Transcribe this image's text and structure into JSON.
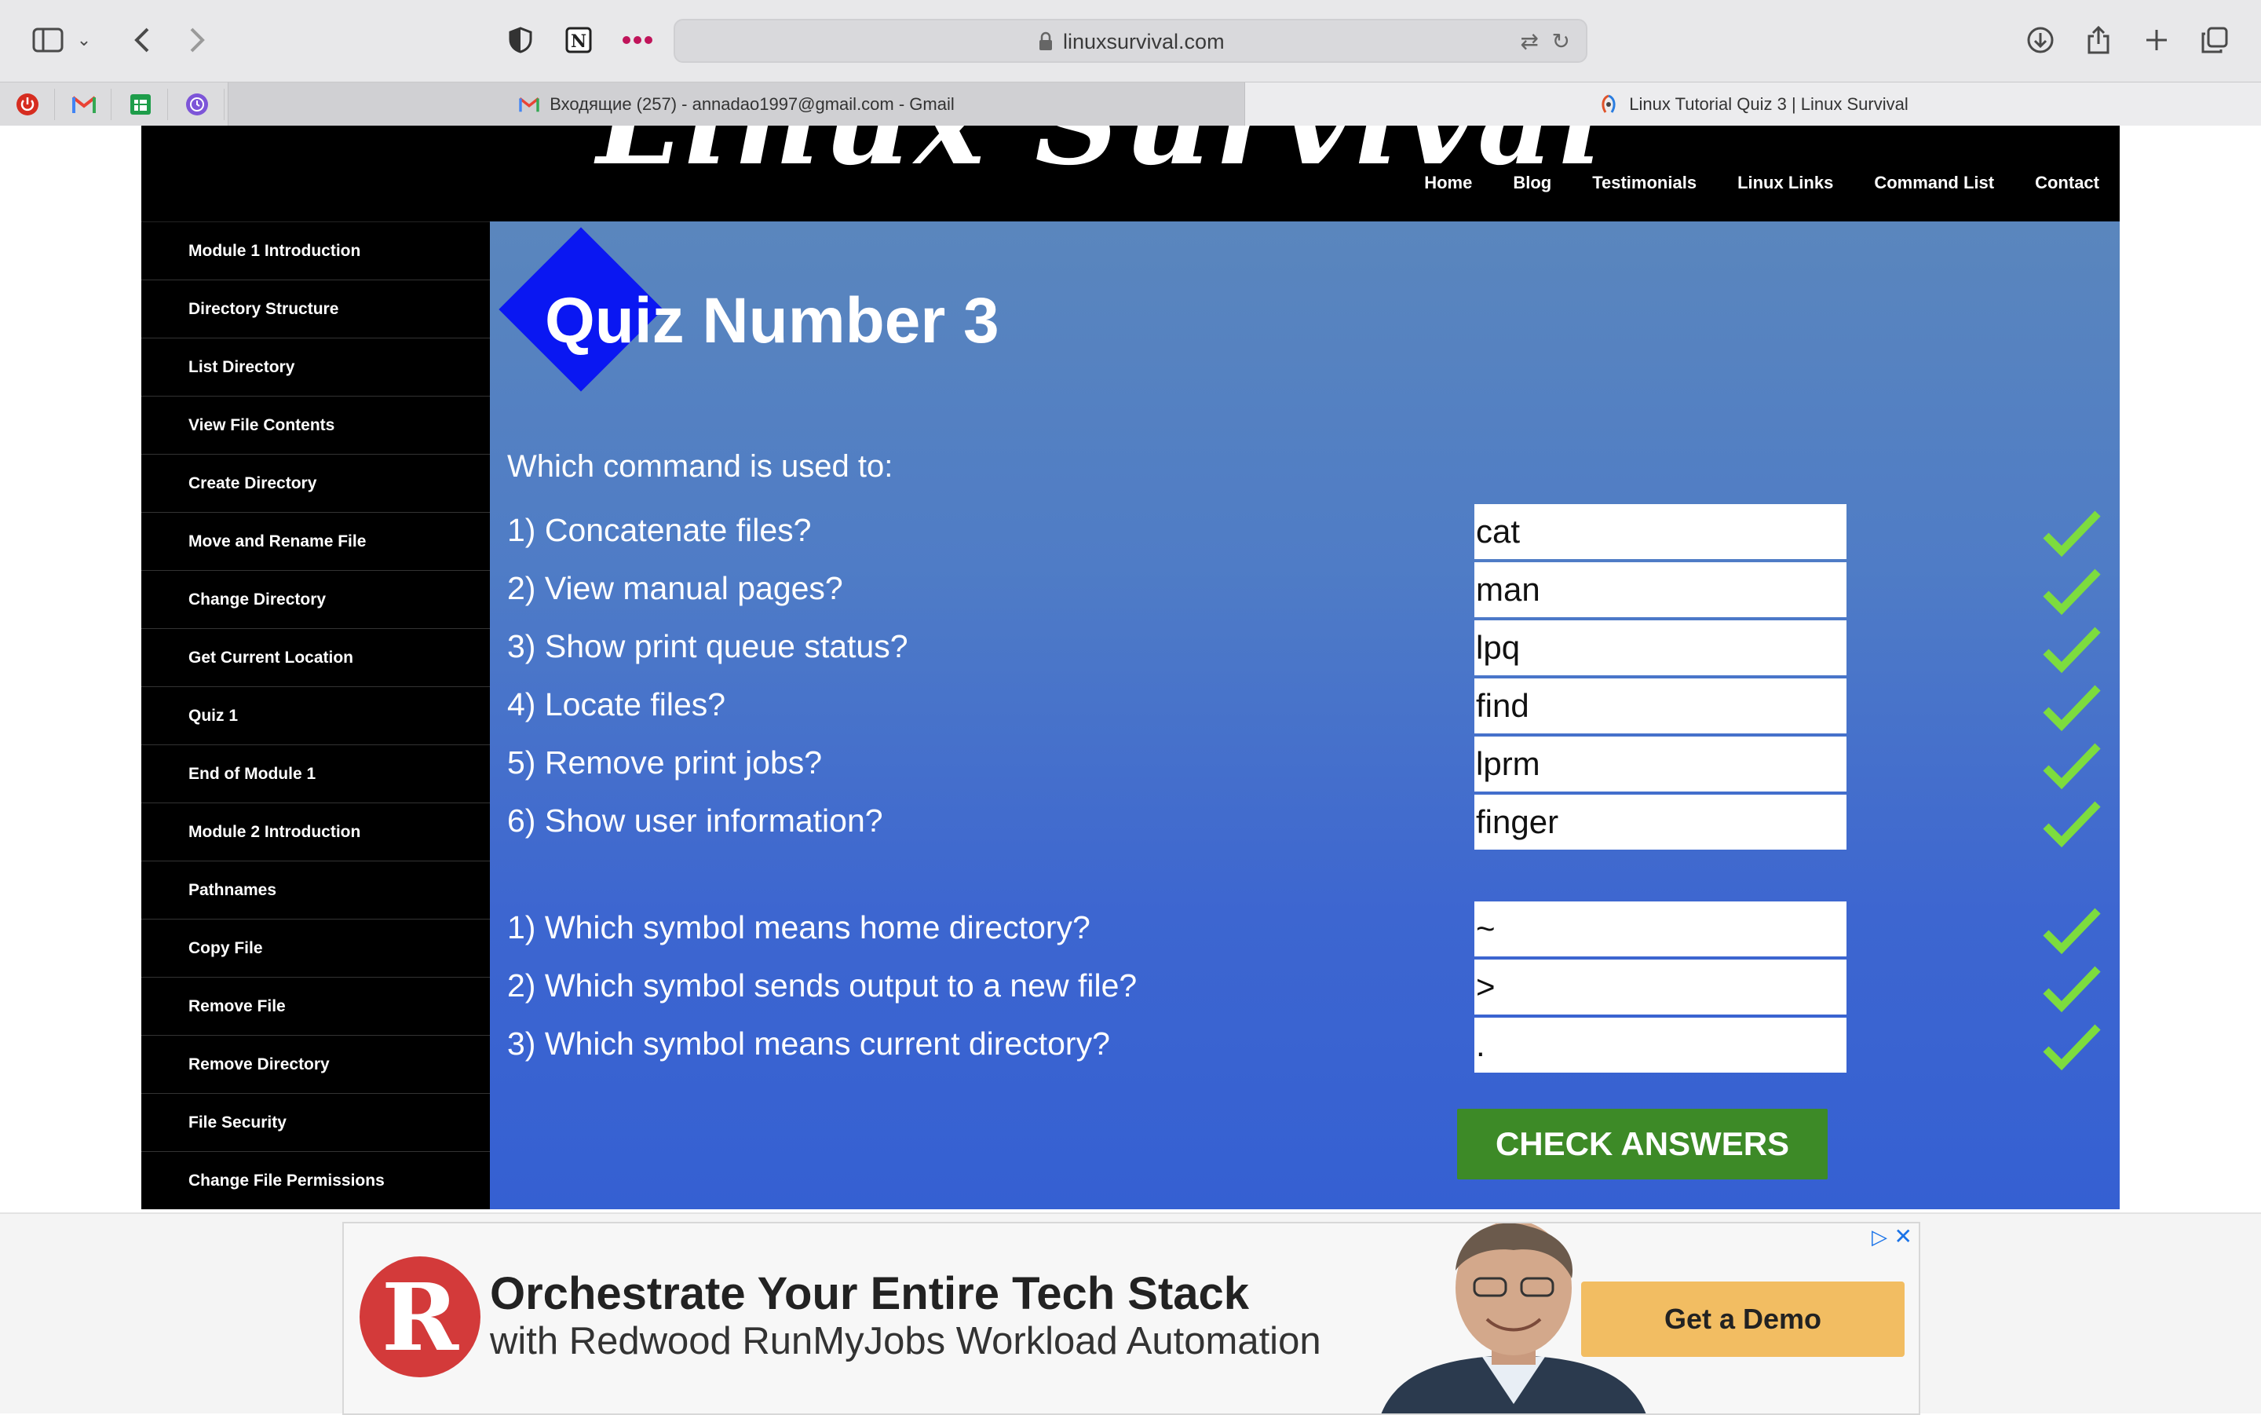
{
  "browser": {
    "url": "linuxsurvival.com",
    "tabs": [
      {
        "label": "Входящие (257) - annadao1997@gmail.com - Gmail",
        "active": false
      },
      {
        "label": "Linux Tutorial Quiz 3 | Linux Survival",
        "active": true
      }
    ],
    "pinned_tabs": [
      "power-icon",
      "gmail-icon",
      "sheets-icon",
      "clock-icon"
    ]
  },
  "site": {
    "logo_text": "Linux Survival",
    "nav": [
      "Home",
      "Blog",
      "Testimonials",
      "Linux Links",
      "Command List",
      "Contact"
    ]
  },
  "sidebar": {
    "items": [
      "Module 1 Introduction",
      "Directory Structure",
      "List Directory",
      "View File Contents",
      "Create Directory",
      "Move and Rename File",
      "Change Directory",
      "Get Current Location",
      "Quiz 1",
      "End of Module 1",
      "Module 2 Introduction",
      "Pathnames",
      "Copy File",
      "Remove File",
      "Remove Directory",
      "File Security",
      "Change File Permissions"
    ]
  },
  "quiz": {
    "title": "Quiz Number 3",
    "heading": "Which command is used to:",
    "questions": [
      {
        "text": "1) Concatenate files?",
        "answer": "cat",
        "correct": true
      },
      {
        "text": "2) View manual pages?",
        "answer": "man",
        "correct": true
      },
      {
        "text": "3) Show print queue status?",
        "answer": "lpq",
        "correct": true
      },
      {
        "text": "4) Locate files?",
        "answer": "find",
        "correct": true
      },
      {
        "text": "5) Remove print jobs?",
        "answer": "lprm",
        "correct": true
      },
      {
        "text": "6) Show user information?",
        "answer": "finger",
        "correct": true
      }
    ],
    "symbol_questions": [
      {
        "text": "1) Which symbol means home directory?",
        "answer": "~",
        "correct": true
      },
      {
        "text": "2) Which symbol sends output to a new file?",
        "answer": ">",
        "correct": true
      },
      {
        "text": "3) Which symbol means current directory?",
        "answer": ".",
        "correct": true
      }
    ],
    "check_button": "CHECK ANSWERS"
  },
  "ad": {
    "headline": "Orchestrate Your Entire Tech Stack",
    "subline": "with Redwood RunMyJobs Workload Automation",
    "cta": "Get a Demo",
    "logo_letter": "R"
  },
  "colors": {
    "content_bg": "#4f7cc6",
    "check_green": "#7ddc3e",
    "button_green": "#3d8a27",
    "diamond_blue": "#0a17f2"
  }
}
